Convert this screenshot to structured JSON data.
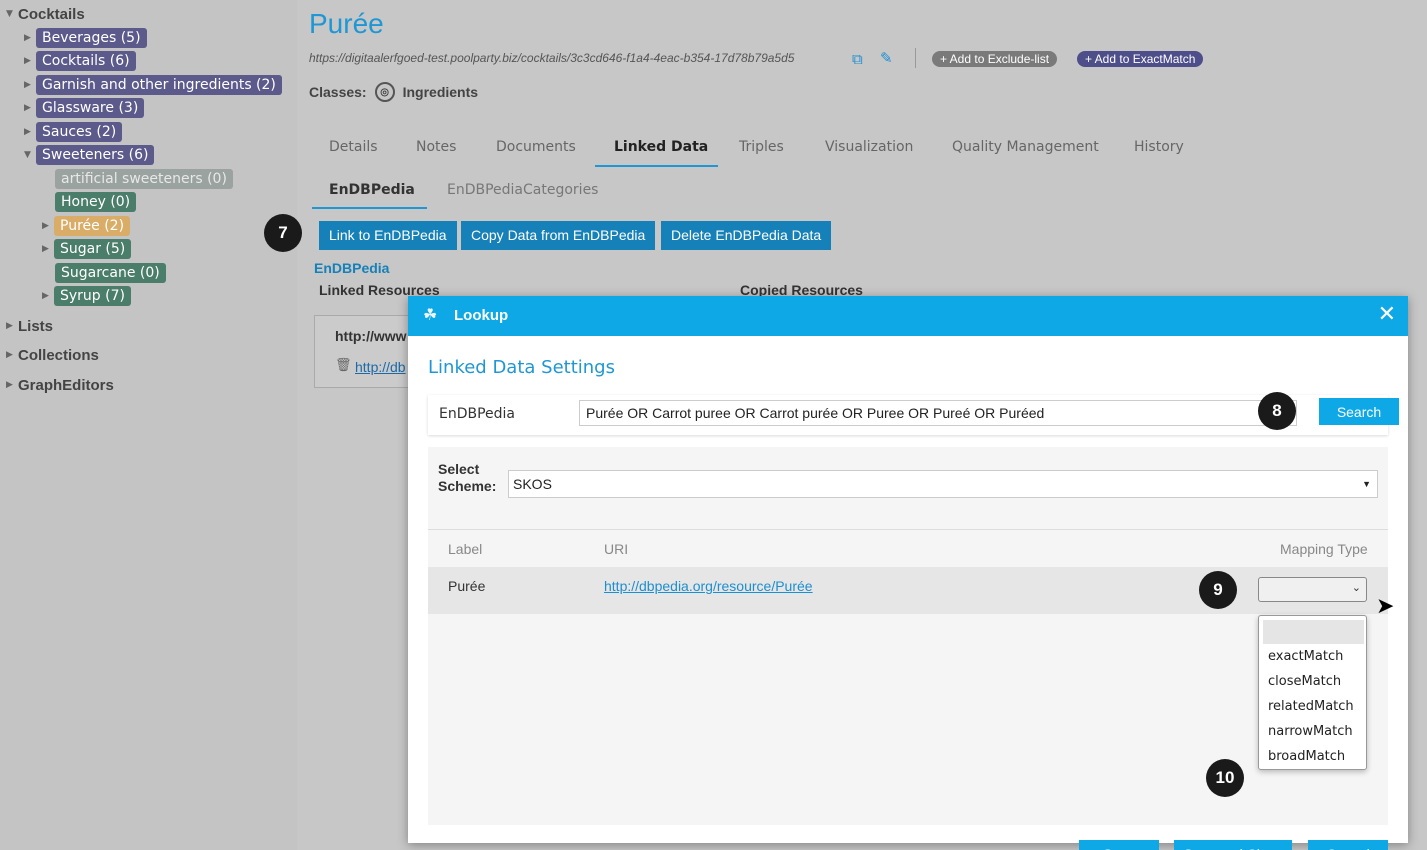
{
  "sidebar": {
    "root": "Cocktails",
    "nodes": [
      {
        "label": "Beverages (5)"
      },
      {
        "label": "Cocktails (6)"
      },
      {
        "label": "Garnish and other ingredients (2)"
      },
      {
        "label": "Glassware (3)"
      },
      {
        "label": "Sauces (2)"
      },
      {
        "label": "Sweeteners (6)"
      }
    ],
    "sweetener_children": [
      {
        "label": "artificial sweeteners (0)"
      },
      {
        "label": "Honey (0)"
      },
      {
        "label": "Purée (2)"
      },
      {
        "label": "Sugar (5)"
      },
      {
        "label": "Sugarcane (0)"
      },
      {
        "label": "Syrup (7)"
      }
    ],
    "other_roots": [
      "Lists",
      "Collections",
      "GraphEditors"
    ]
  },
  "header": {
    "title": "Purée",
    "uri": "https://digitaalerfgoed-test.poolparty.biz/cocktails/3c3cd646-f1a4-4eac-b354-17d78b79a5d5",
    "exclude_button": "+ Add to Exclude-list",
    "exactmatch_button": "+ Add to ExactMatch",
    "classes_label": "Classes:",
    "class_name": "Ingredients"
  },
  "tabs": [
    "Details",
    "Notes",
    "Documents",
    "Linked Data",
    "Triples",
    "Visualization",
    "Quality Management",
    "History"
  ],
  "subtabs": [
    "EnDBPedia",
    "EnDBPediaCategories"
  ],
  "actions": {
    "link": "Link to EnDBPedia",
    "copy": "Copy Data from EnDBPedia",
    "delete": "Delete EnDBPedia Data"
  },
  "markers": {
    "m7": "7",
    "m8": "8",
    "m9": "9",
    "m10": "10"
  },
  "linked": {
    "heading": "EnDBPedia",
    "linked_resources": "Linked Resources",
    "copied_resources": "Copied Resources",
    "resource_title": "http://www",
    "resource_link": "http://db"
  },
  "modal": {
    "title": "Lookup",
    "section_title": "Linked Data Settings",
    "search_label": "EnDBPedia",
    "search_value": "Purée OR Carrot puree OR Carrot purée OR Puree OR Pureé OR Puréed",
    "search_button": "Search",
    "scheme_label": "Select Scheme:",
    "scheme_value": "SKOS",
    "columns": {
      "label": "Label",
      "uri": "URI",
      "mapping": "Mapping Type"
    },
    "row": {
      "label": "Purée",
      "uri": "http://dbpedia.org/resource/Purée"
    },
    "mapping_options": [
      "exactMatch",
      "closeMatch",
      "relatedMatch",
      "narrowMatch",
      "broadMatch"
    ],
    "buttons": {
      "save": "Save",
      "save_close": "Save and Close",
      "cancel": "Cancel"
    }
  }
}
